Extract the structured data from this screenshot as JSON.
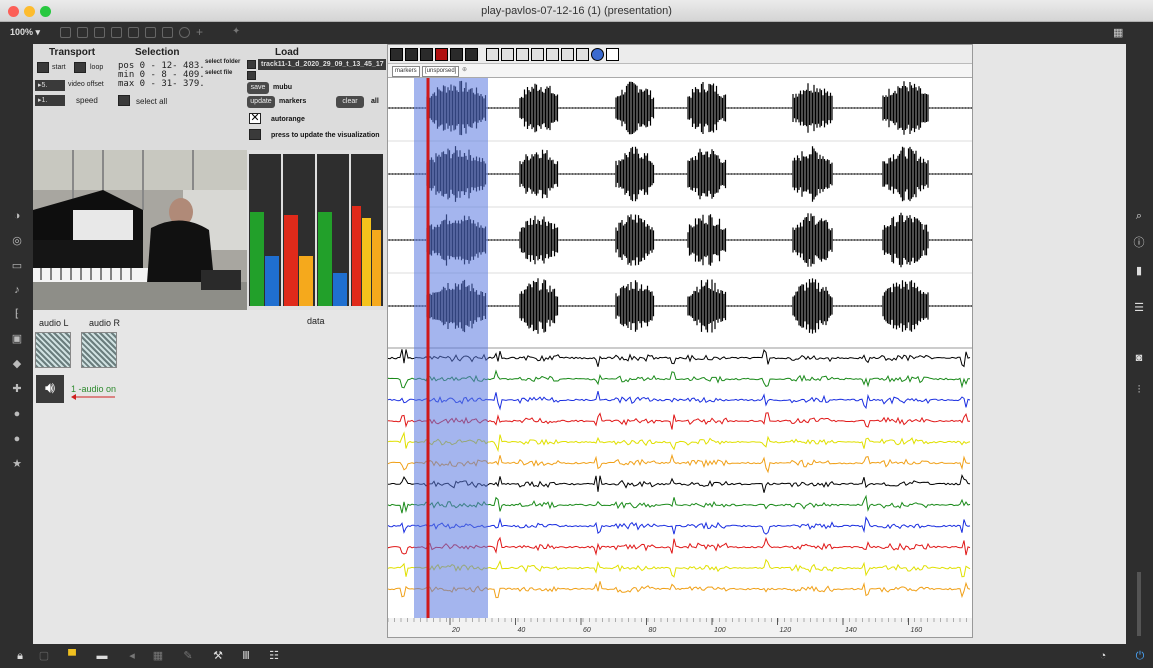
{
  "window": {
    "title": "play-pavlos-07-12-16 (1) (presentation)",
    "zoom": "100% ▾"
  },
  "transport": {
    "header": "Transport",
    "start_label": "start",
    "loop_label": "loop",
    "video_offset_label": "video offset",
    "speed_label": "speed",
    "offset_value": "▸5.",
    "speed_value": "▸1."
  },
  "selection": {
    "header": "Selection",
    "pos": "pos   0  - 12- 483.",
    "min": "min   0  - 8  - 409.",
    "max": "max  0  - 31- 379.",
    "select_all": "select all"
  },
  "load": {
    "header": "Load",
    "select_folder": "select folder",
    "select_file": "select file",
    "file_menu": "track11-1_d_2020_29_09_t_13_45_17",
    "save_label": "save",
    "mubu_label": "mubu",
    "update_label": "update",
    "markers_label": "markers",
    "clear_label": "clear",
    "all_label": "all",
    "autorange_label": "autorange",
    "press_update_label": "press to update the visualization"
  },
  "meters": {
    "label": "data",
    "groups": [
      {
        "bars": [
          {
            "color": "#22a02a",
            "level": 0.62
          },
          {
            "color": "#1f6fd0",
            "level": 0.33
          }
        ]
      },
      {
        "bars": [
          {
            "color": "#e02a1a",
            "level": 0.6
          },
          {
            "color": "#f5a91c",
            "level": 0.33
          }
        ]
      },
      {
        "bars": [
          {
            "color": "#22a02a",
            "level": 0.62
          },
          {
            "color": "#1f6fd0",
            "level": 0.22
          }
        ]
      },
      {
        "bars": [
          {
            "color": "#e02a1a",
            "level": 0.66
          },
          {
            "color": "#f5c21c",
            "level": 0.58
          },
          {
            "color": "#f5a91c",
            "level": 0.5
          }
        ]
      }
    ]
  },
  "audio": {
    "left_label": "audio L",
    "right_label": "audio R",
    "on_label": "1 -audio on"
  },
  "waveform": {
    "tabs": [
      "markers",
      "[unsporsed]"
    ],
    "ruler_ticks": [
      "20",
      "40",
      "60",
      "80",
      "100",
      "120",
      "140",
      "160"
    ],
    "selection_color": "#5a78e0",
    "cursor_color": "#d01818",
    "channel_colors": [
      "#000000",
      "#1a8a1a",
      "#1a2ee0",
      "#e01818",
      "#e0e000",
      "#f0a018",
      "#000000",
      "#1a8a1a",
      "#1a2ee0",
      "#e01818",
      "#e0e000",
      "#f0a018"
    ]
  }
}
